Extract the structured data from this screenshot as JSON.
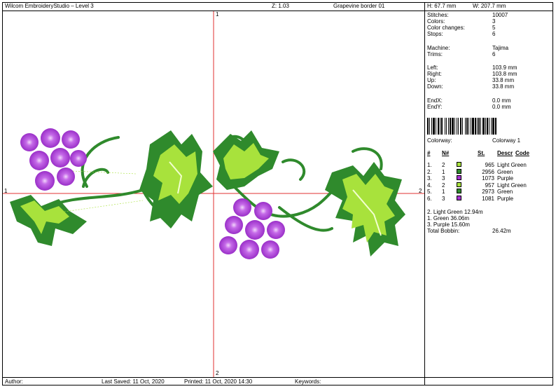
{
  "header": {
    "app_title": "Wilcom EmbroideryStudio – Level 3",
    "zoom": "Z: 1.03",
    "design_name": "Grapevine border 01",
    "height": "H: 67.7 mm",
    "width": "W: 207.7 mm"
  },
  "footer": {
    "author_label": "Author:",
    "last_saved": "Last Saved: 11 Oct, 2020",
    "printed": "Printed: 11 Oct, 2020 14:30",
    "keywords_label": "Keywords:"
  },
  "canvas": {
    "marker_top": "1",
    "marker_bottom": "2",
    "marker_left": "1",
    "marker_right": "2",
    "crosshair_color": "#e03030",
    "colors": {
      "purple": "#a632d0",
      "light_green": "#a8e23c",
      "green": "#2f8a2c"
    }
  },
  "stats": {
    "stitches": {
      "label": "Stitches:",
      "value": "10007"
    },
    "colors": {
      "label": "Colors:",
      "value": "3"
    },
    "color_changes": {
      "label": "Color changes:",
      "value": "5"
    },
    "stops": {
      "label": "Stops:",
      "value": "6"
    },
    "machine": {
      "label": "Machine:",
      "value": "Tajima"
    },
    "trims": {
      "label": "Trims:",
      "value": "6"
    },
    "left": {
      "label": "Left:",
      "value": "103.9 mm"
    },
    "right": {
      "label": "Right:",
      "value": "103.8 mm"
    },
    "up": {
      "label": "Up:",
      "value": "33.8 mm"
    },
    "down": {
      "label": "Down:",
      "value": "33.8 mm"
    },
    "endx": {
      "label": "EndX:",
      "value": "0.0 mm"
    },
    "endy": {
      "label": "EndY:",
      "value": "0.0 mm"
    },
    "colorway": {
      "label": "Colorway:",
      "value": "Colorway 1"
    }
  },
  "color_table": {
    "headers": {
      "index": "#",
      "needle": "N#",
      "stitches": "St.",
      "descr": "Descr",
      "code": "Code"
    },
    "rows": [
      {
        "index": "1.",
        "needle": "2",
        "stitches": "965",
        "name": "Light Green",
        "color": "#a8e23c"
      },
      {
        "index": "2.",
        "needle": "1",
        "stitches": "2956",
        "name": "Green",
        "color": "#2f8a2c"
      },
      {
        "index": "3.",
        "needle": "3",
        "stitches": "1073",
        "name": "Purple",
        "color": "#a632d0"
      },
      {
        "index": "4.",
        "needle": "2",
        "stitches": "957",
        "name": "Light Green",
        "color": "#a8e23c"
      },
      {
        "index": "5.",
        "needle": "1",
        "stitches": "2973",
        "name": "Green",
        "color": "#2f8a2c"
      },
      {
        "index": "6.",
        "needle": "3",
        "stitches": "1081",
        "name": "Purple",
        "color": "#a632d0"
      }
    ]
  },
  "bobbin": {
    "lines": [
      "2. Light Green 12.94m",
      "1. Green 36.06m",
      "3. Purple 15.60m"
    ],
    "total_label": "Total Bobbin:",
    "total_value": "26.42m"
  }
}
